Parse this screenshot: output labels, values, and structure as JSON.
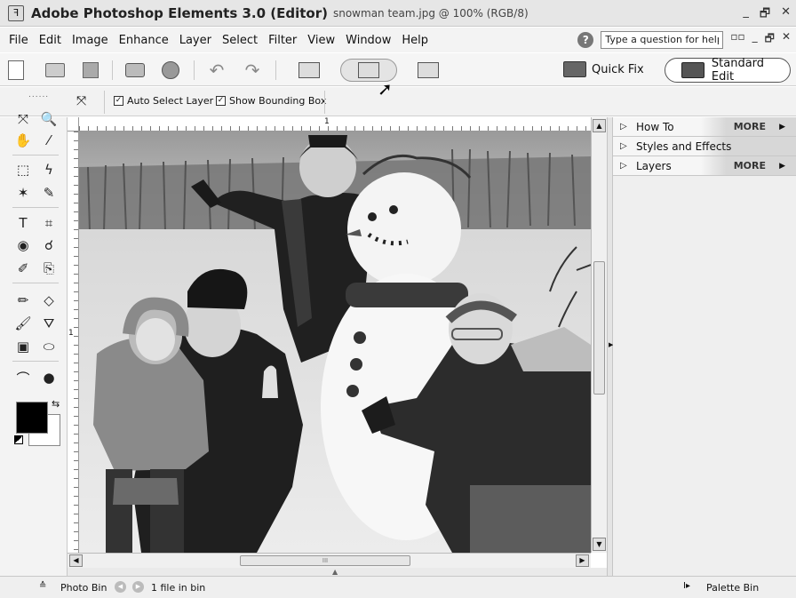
{
  "window": {
    "app_name": "Adobe Photoshop Elements 3.0 (Editor)",
    "document": "snowman team.jpg @ 100% (RGB/8)",
    "minimize": "_",
    "restore": "🗗",
    "close": "✕"
  },
  "menubar": {
    "items": [
      "File",
      "Edit",
      "Image",
      "Enhance",
      "Layer",
      "Select",
      "Filter",
      "View",
      "Window",
      "Help"
    ],
    "help_placeholder": "Type a question for help",
    "doc_controls": [
      "▫▫",
      "_",
      "🗗",
      "✕"
    ]
  },
  "toolbar": {
    "quick_fix": "Quick Fix",
    "standard_edit": "Standard Edit",
    "buttons": [
      "new-icon",
      "open-icon",
      "save-icon",
      "print-icon",
      "email-icon",
      "undo-icon",
      "redo-icon",
      "rotate-left-icon",
      "rotate-right-icon",
      "rotate-right-alt-icon"
    ]
  },
  "options": {
    "auto_select": "Auto Select Layer",
    "show_bounding": "Show Bounding Box",
    "auto_select_checked": true,
    "show_bounding_checked": true
  },
  "toolbox": {
    "tools": [
      {
        "glyph": "⤧",
        "name": "move-tool-icon"
      },
      {
        "glyph": "🔍",
        "name": "zoom-tool-icon"
      },
      {
        "glyph": "✋",
        "name": "hand-tool-icon"
      },
      {
        "glyph": "⁄",
        "name": "eyedropper-tool-icon"
      },
      {
        "glyph": "⬚",
        "name": "marquee-tool-icon"
      },
      {
        "glyph": "ϟ",
        "name": "lasso-tool-icon"
      },
      {
        "glyph": "✶",
        "name": "magic-wand-tool-icon"
      },
      {
        "glyph": "✎",
        "name": "selection-brush-tool-icon"
      },
      {
        "glyph": "T",
        "name": "type-tool-icon"
      },
      {
        "glyph": "⌗",
        "name": "crop-tool-icon"
      },
      {
        "glyph": "◉",
        "name": "cookie-cutter-tool-icon"
      },
      {
        "glyph": "☌",
        "name": "red-eye-tool-icon"
      },
      {
        "glyph": "✐",
        "name": "healing-brush-tool-icon"
      },
      {
        "glyph": "⎘",
        "name": "clone-stamp-tool-icon"
      },
      {
        "glyph": "✏",
        "name": "pencil-tool-icon"
      },
      {
        "glyph": "◇",
        "name": "eraser-tool-icon"
      },
      {
        "glyph": "🖌",
        "name": "brush-tool-icon"
      },
      {
        "glyph": "⛛",
        "name": "paint-bucket-tool-icon"
      },
      {
        "glyph": "▣",
        "name": "gradient-tool-icon"
      },
      {
        "glyph": "⬭",
        "name": "shape-tool-icon"
      },
      {
        "glyph": "⌒",
        "name": "blur-tool-icon"
      },
      {
        "glyph": "●",
        "name": "sponge-tool-icon"
      }
    ]
  },
  "ruler": {
    "top_mark": "1",
    "left_mark": "1"
  },
  "palette": {
    "rows": [
      {
        "label": "How To",
        "more": "MORE"
      },
      {
        "label": "Styles and Effects",
        "more": ""
      },
      {
        "label": "Layers",
        "more": "MORE"
      }
    ],
    "more_arrow": "▶",
    "collapsed_arrow": "▷"
  },
  "statusbar": {
    "photo_bin": "Photo Bin",
    "count": "1 file in bin",
    "palette_bin": "Palette Bin",
    "up_arrow": "≙",
    "pal_arrow": "I▸"
  },
  "scroll": {
    "grip": "III"
  }
}
